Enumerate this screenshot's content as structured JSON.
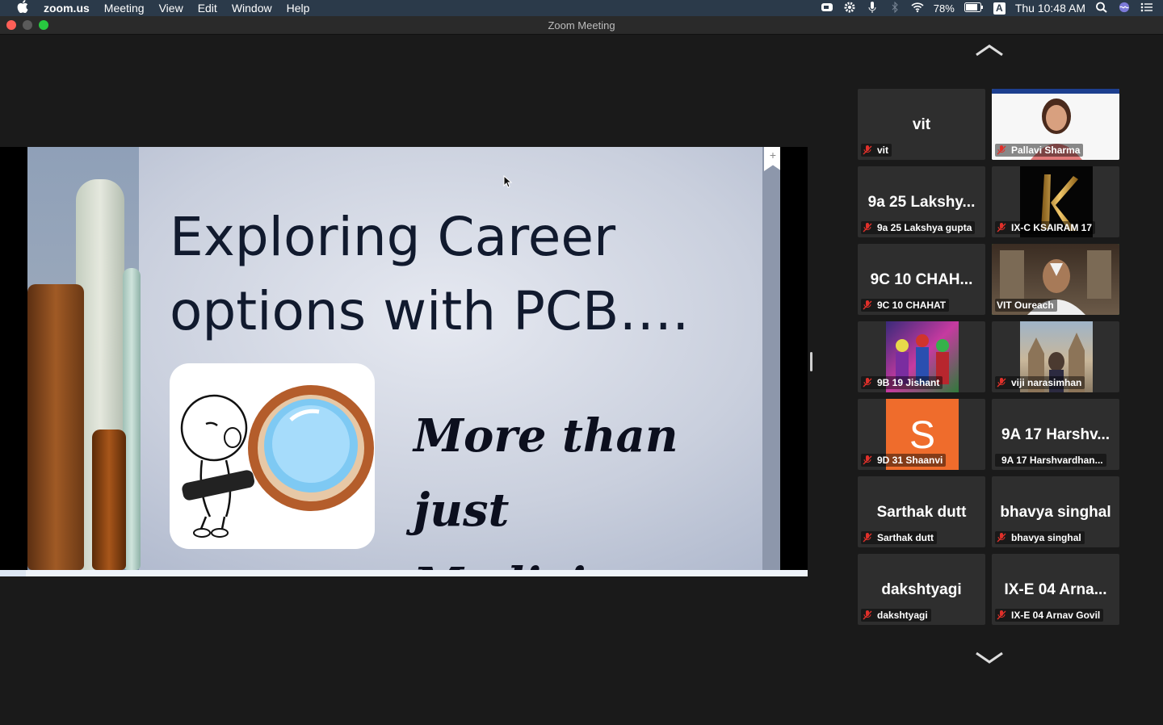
{
  "menubar": {
    "app": "zoom.us",
    "menus": [
      "Meeting",
      "View",
      "Edit",
      "Window",
      "Help"
    ],
    "battery": "78%",
    "input_source": "A",
    "clock": "Thu 10:48 AM"
  },
  "window": {
    "title": "Zoom Meeting"
  },
  "slide": {
    "title_line1": "Exploring Career",
    "title_line2": "options with PCB….",
    "sub_line1": "More than just",
    "sub_line2": "Medicine",
    "bookmark_symbol": "+"
  },
  "gallery": {
    "nav_up_icon": "chevron-up-icon",
    "nav_down_icon": "chevron-down-icon",
    "tiles": [
      {
        "big": "vit",
        "label": "vit",
        "muted": true,
        "video": false
      },
      {
        "big": "",
        "label": "Pallavi Sharma",
        "muted": true,
        "video": true
      },
      {
        "big": "9a 25 Lakshy...",
        "label": "9a 25 Lakshya gupta",
        "muted": true,
        "video": false
      },
      {
        "big": "",
        "label": "IX-C KSAIRAM 17",
        "muted": true,
        "video": true
      },
      {
        "big": "9C 10 CHAH...",
        "label": "9C 10 CHAHAT",
        "muted": true,
        "video": false
      },
      {
        "big": "",
        "label": "VIT Oureach",
        "muted": false,
        "video": true,
        "active": true
      },
      {
        "big": "",
        "label": "9B 19 Jishant",
        "muted": true,
        "video": true
      },
      {
        "big": "",
        "label": "viji narasimhan",
        "muted": true,
        "video": true
      },
      {
        "big": "",
        "label": "9D 31 Shaanvi",
        "muted": true,
        "video": true,
        "avatar_letter": "S"
      },
      {
        "big": "9A 17 Harshv...",
        "label": "9A 17 Harshvardhan...",
        "muted": false,
        "video": false
      },
      {
        "big": "Sarthak dutt",
        "label": "Sarthak dutt",
        "muted": true,
        "video": false
      },
      {
        "big": "bhavya singhal",
        "label": "bhavya singhal",
        "muted": true,
        "video": false
      },
      {
        "big": "dakshtyagi",
        "label": "dakshtyagi",
        "muted": true,
        "video": false
      },
      {
        "big": "IX-E 04 Arna...",
        "label": "IX-E 04 Arnav Govil",
        "muted": true,
        "video": false
      }
    ]
  },
  "colors": {
    "active_speaker": "#2fd042",
    "mute_red": "#e0302a",
    "tile_bg": "#2e2e2e"
  }
}
